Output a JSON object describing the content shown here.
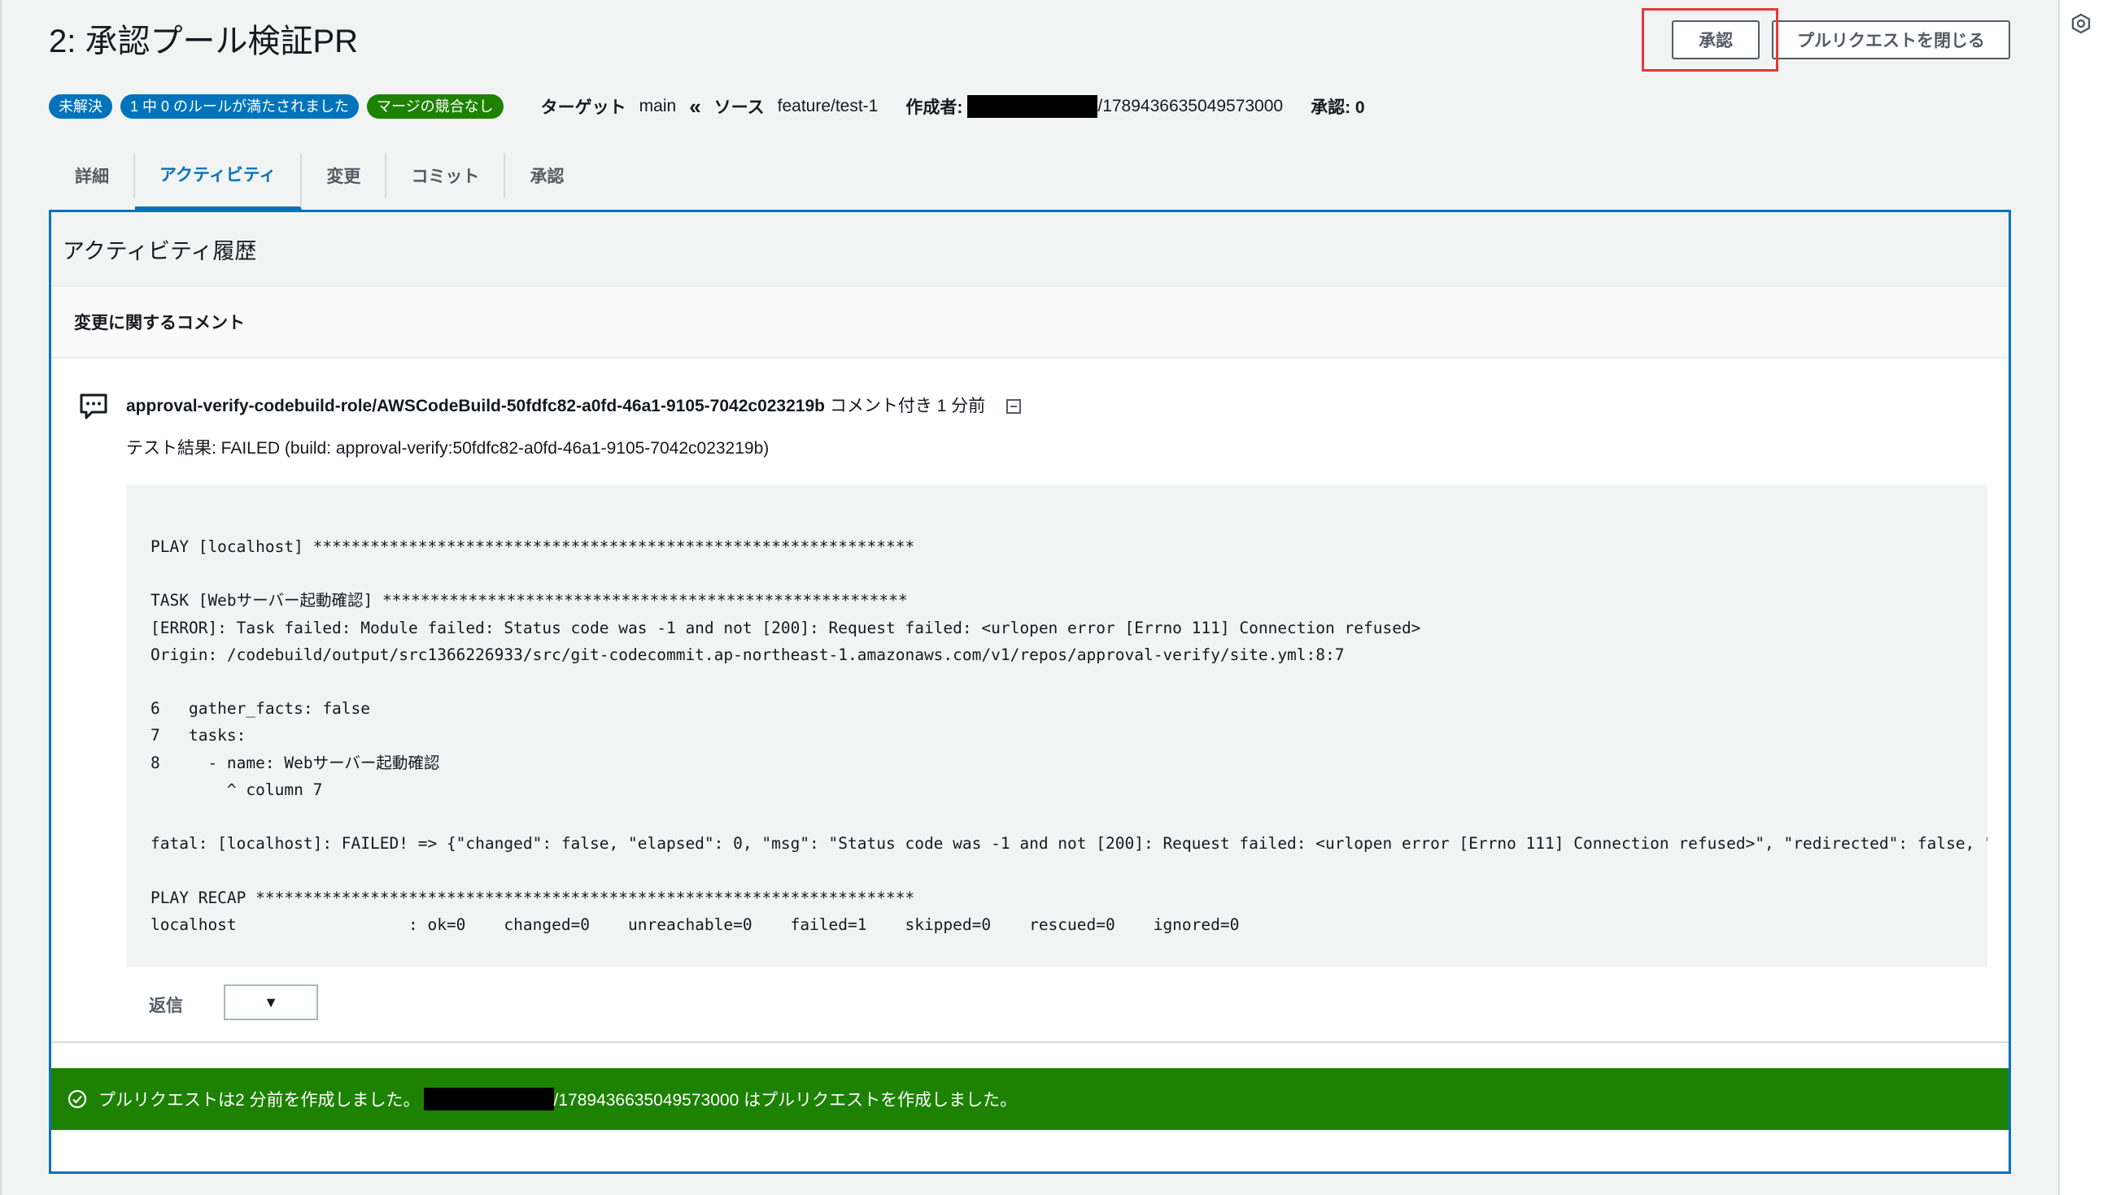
{
  "page": {
    "title": "2: 承認プール検証PR"
  },
  "actions": {
    "approve_label": "承認",
    "close_pr_label": "プルリクエストを閉じる"
  },
  "meta": {
    "badges": [
      {
        "label": "未解決",
        "color": "#0073bb"
      },
      {
        "label": "1 中 0 のルールが満たされました",
        "color": "#0073bb"
      },
      {
        "label": "マージの競合なし",
        "color": "#1d8102"
      }
    ],
    "target_label": "ターゲット",
    "target_value": "main",
    "source_label": "ソース",
    "source_value": "feature/test-1",
    "author_label": "作成者:",
    "author_suffix": "/1789436635049573000",
    "approvals_label": "承認: 0"
  },
  "tabs": [
    {
      "label": "詳細",
      "active": false
    },
    {
      "label": "アクティビティ",
      "active": true
    },
    {
      "label": "変更",
      "active": false
    },
    {
      "label": "コミット",
      "active": false
    },
    {
      "label": "承認",
      "active": false
    }
  ],
  "activity": {
    "heading": "アクティビティ履歴",
    "section_title": "変更に関するコメント",
    "comment": {
      "author": "approval-verify-codebuild-role/AWSCodeBuild-50fdfc82-a0fd-46a1-9105-7042c023219b",
      "meta": " コメント付き 1 分前",
      "text": "テスト結果: FAILED (build: approval-verify:50fdfc82-a0fd-46a1-9105-7042c023219b)",
      "code_lines": [
        "PLAY [localhost] ***************************************************************",
        "",
        "TASK [Webサーバー起動確認] *******************************************************",
        "[ERROR]: Task failed: Module failed: Status code was -1 and not [200]: Request failed: <urlopen error [Errno 111] Connection refused>",
        "Origin: /codebuild/output/src1366226933/src/git-codecommit.ap-northeast-1.amazonaws.com/v1/repos/approval-verify/site.yml:8:7",
        "",
        "6   gather_facts: false",
        "7   tasks:",
        "8     - name: Webサーバー起動確認",
        "        ^ column 7",
        "",
        "fatal: [localhost]: FAILED! => {\"changed\": false, \"elapsed\": 0, \"msg\": \"Status code was -1 and not [200]: Request failed: <urlopen error [Errno 111] Connection refused>\", \"redirected\": false, \"",
        "",
        "PLAY RECAP *********************************************************************",
        "localhost                  : ok=0    changed=0    unreachable=0    failed=1    skipped=0    rescued=0    ignored=0"
      ]
    },
    "reply_label": "返信",
    "reply_select_value": "▼"
  },
  "flash": {
    "prefix": "プルリクエストは2 分前を作成しました。",
    "suffix": "/1789436635049573000 はプルリクエストを作成しました。",
    "color": "#1d8102"
  },
  "icons": {
    "comment": "comment-bubble-icon",
    "collapse": "collapse-icon",
    "flash": "check-circle-icon",
    "rail": "settings-hex-icon"
  }
}
